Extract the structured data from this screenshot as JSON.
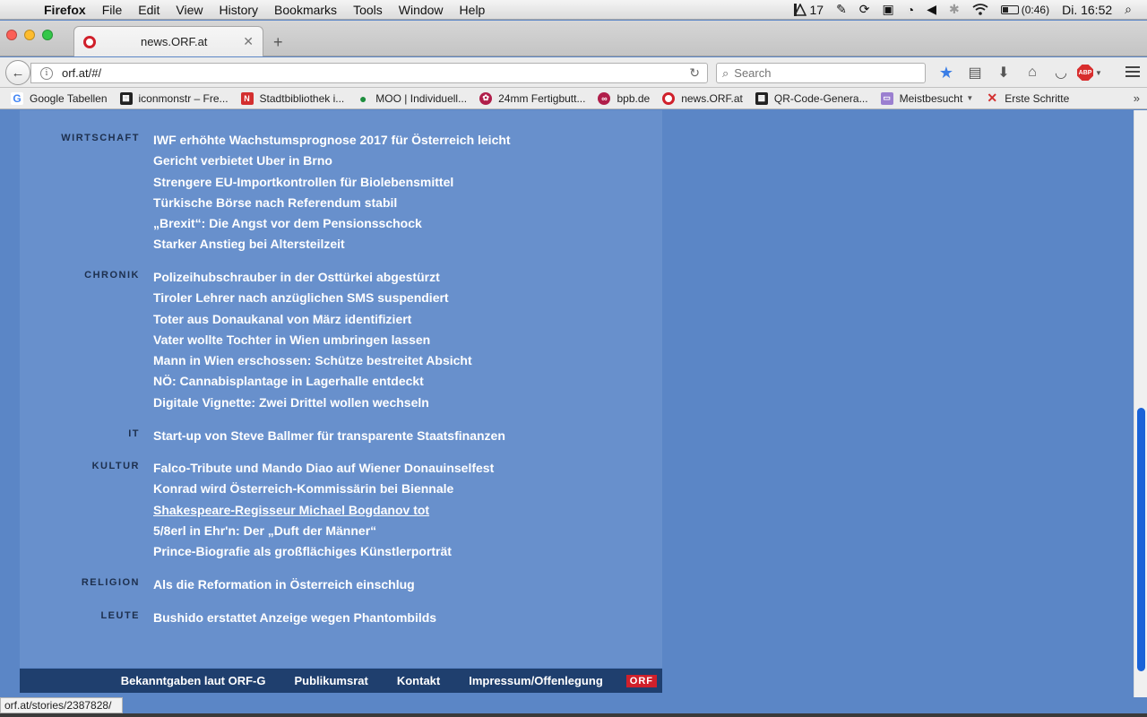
{
  "menubar": {
    "app": "Firefox",
    "items": [
      "File",
      "Edit",
      "View",
      "History",
      "Bookmarks",
      "Tools",
      "Window",
      "Help"
    ],
    "status": {
      "adobe_count": "17",
      "battery": "(0:46)",
      "clock": "Di. 16:52"
    }
  },
  "tab": {
    "title": "news.ORF.at",
    "close": "✕",
    "new": "+"
  },
  "navbar": {
    "url": "orf.at/#/",
    "search_placeholder": "Search"
  },
  "bookmarks": [
    {
      "label": "Google Tabellen",
      "icon": "google-icon"
    },
    {
      "label": "iconmonstr – Fre...",
      "icon": "iconmonstr-icon"
    },
    {
      "label": "Stadtbibliothek i...",
      "icon": "n-icon"
    },
    {
      "label": "MOO | Individuell...",
      "icon": "drop-icon"
    },
    {
      "label": "24mm Fertigbutt...",
      "icon": "button-icon"
    },
    {
      "label": "bpb.de",
      "icon": "bpb-icon"
    },
    {
      "label": "news.ORF.at",
      "icon": "orf-icon"
    },
    {
      "label": "QR-Code-Genera...",
      "icon": "qr-icon"
    },
    {
      "label": "Meistbesucht",
      "icon": "folder-icon"
    },
    {
      "label": "Erste Schritte",
      "icon": "x-icon"
    }
  ],
  "sections": [
    {
      "label": "WIRTSCHAFT",
      "links": [
        "IWF erhöhte Wachstumsprognose 2017 für Österreich leicht",
        "Gericht verbietet Uber in Brno",
        "Strengere EU-Importkontrollen für Biolebensmittel",
        "Türkische Börse nach Referendum stabil",
        "„Brexit“: Die Angst vor dem Pensionsschock",
        "Starker Anstieg bei Altersteilzeit"
      ]
    },
    {
      "label": "CHRONIK",
      "links": [
        "Polizeihubschrauber in der Osttürkei abgestürzt",
        "Tiroler Lehrer nach anzüglichen SMS suspendiert",
        "Toter aus Donaukanal von März identifiziert",
        "Vater wollte Tochter in Wien umbringen lassen",
        "Mann in Wien erschossen: Schütze bestreitet Absicht",
        "NÖ: Cannabisplantage in Lagerhalle entdeckt",
        "Digitale Vignette: Zwei Drittel wollen wechseln"
      ]
    },
    {
      "label": "IT",
      "links": [
        "Start-up von Steve Ballmer für transparente Staatsfinanzen"
      ]
    },
    {
      "label": "KULTUR",
      "links": [
        "Falco-Tribute und Mando Diao auf Wiener Donauinselfest",
        "Konrad wird Österreich-Kommissärin bei Biennale",
        "Shakespeare-Regisseur Michael Bogdanov tot",
        "5/8erl in Ehr'n: Der „Duft der Männer“",
        "Prince-Biografie als großflächiges Künstlerporträt"
      ]
    },
    {
      "label": "RELIGION",
      "links": [
        "Als die Reformation in Österreich einschlug"
      ]
    },
    {
      "label": "LEUTE",
      "links": [
        "Bushido erstattet Anzeige wegen Phantombilds"
      ]
    }
  ],
  "footer": {
    "links": [
      "Bekanntgaben laut ORF-G",
      "Publikumsrat",
      "Kontakt",
      "Impressum/Offenlegung"
    ],
    "logo": "ORF"
  },
  "statusbar": "orf.at/stories/2387828/"
}
